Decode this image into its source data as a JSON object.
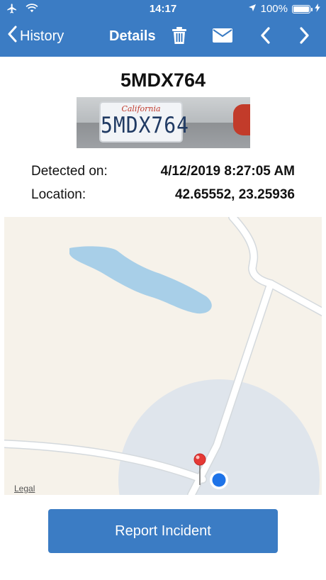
{
  "status_bar": {
    "time": "14:17",
    "battery": "100%",
    "icons": [
      "airplane-icon",
      "wifi-icon",
      "location-arrow-icon",
      "battery-icon",
      "charging-bolt-icon"
    ]
  },
  "nav": {
    "back_label": "History",
    "title": "Details",
    "icons": [
      "trash-icon",
      "mail-icon",
      "chevron-left-icon",
      "chevron-right-icon"
    ]
  },
  "plate": {
    "number": "5MDX764",
    "photo_state_text": "California",
    "photo_plate_text": "5MDX764"
  },
  "details": {
    "detected_label": "Detected on:",
    "detected_value": "4/12/2019 8:27:05 AM",
    "location_label": "Location:",
    "location_value": "42.65552, 23.25936"
  },
  "map": {
    "legal_label": "Legal"
  },
  "action": {
    "report_label": "Report Incident"
  },
  "colors": {
    "accent": "#3b7cc4",
    "map_background": "#f6f2ea",
    "water": "#a8cfe8",
    "pin": "#e53935",
    "user_location": "#1e73e8"
  }
}
